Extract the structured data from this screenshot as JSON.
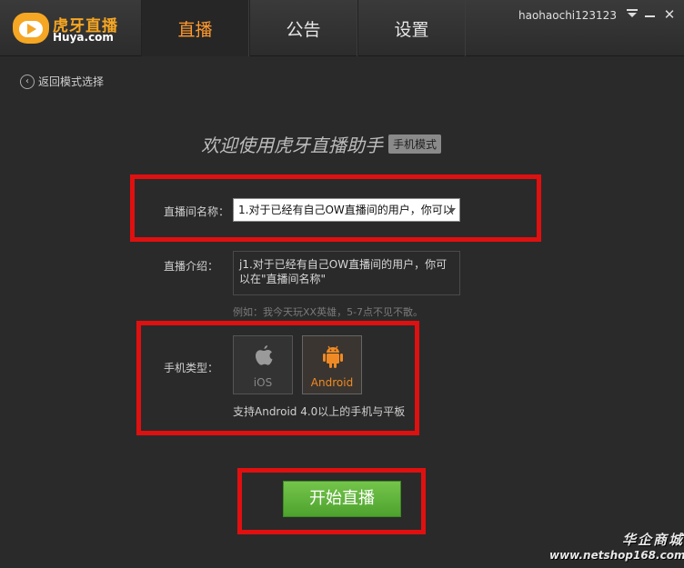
{
  "app": {
    "logo_cn": "虎牙直播",
    "logo_en": "Huya.com",
    "username": "haohaochi123123"
  },
  "tabs": [
    {
      "label": "直播",
      "active": true
    },
    {
      "label": "公告",
      "active": false
    },
    {
      "label": "设置",
      "active": false
    }
  ],
  "window_controls": {
    "close": "✕"
  },
  "back": {
    "icon": "‹",
    "label": "返回模式选择"
  },
  "welcome": {
    "title": "欢迎使用虎牙直播助手",
    "badge": "手机模式"
  },
  "form": {
    "room_name_label": "直播间名称：",
    "room_name_value": "1.对于已经有自己OW直播间的用户，你可以",
    "intro_label": "直播介绍：",
    "intro_value": "j1.对于已经有自己OW直播间的用户，你可以在\"直播间名称\"",
    "intro_hint": "例如：我今天玩XX英雄，5-7点不见不散。",
    "phone_type_label": "手机类型：",
    "phone_options": [
      {
        "label": "iOS",
        "icon": "apple-icon",
        "selected": false
      },
      {
        "label": "Android",
        "icon": "android-icon",
        "selected": true
      }
    ],
    "support_text": "支持Android 4.0以上的手机与平板"
  },
  "start_button": "开始直播",
  "watermark": {
    "text": "华企商城",
    "url": "www.netshop168.com"
  },
  "colors": {
    "accent": "#ff9a2e",
    "highlight": "#e01010",
    "start": "#5cb43a"
  }
}
